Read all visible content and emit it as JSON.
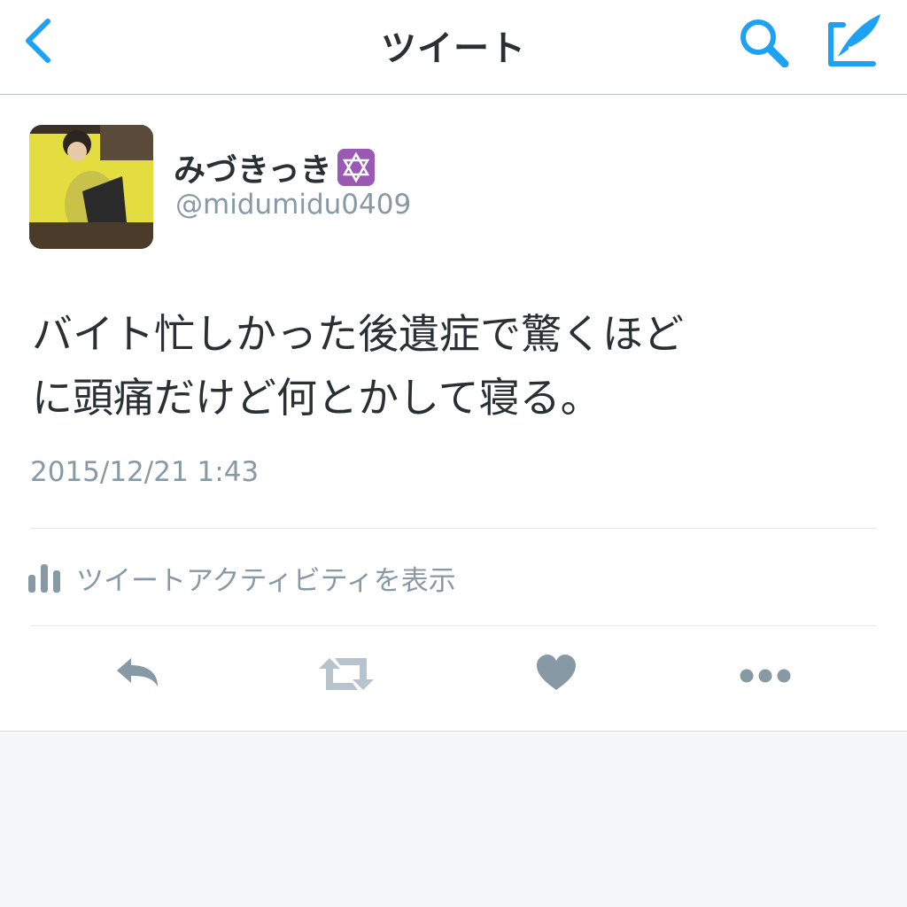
{
  "header": {
    "title": "ツイート",
    "back_icon": "chevron-left-icon",
    "search_icon": "search-icon",
    "compose_icon": "compose-icon",
    "accent_color": "#1da1f2"
  },
  "tweet": {
    "author": {
      "display_name": "みづきっき",
      "badge_icon": "star-of-david-icon",
      "handle": "@midumidu0409"
    },
    "text_line1": "バイト忙しかった後遺症で驚くほど",
    "text_line2": "に頭痛だけど何とかして寝る。",
    "timestamp": "2015/12/21 1:43",
    "activity_label": "ツイートアクティビティを表示"
  },
  "actions": {
    "reply_icon": "reply-icon",
    "retweet_icon": "retweet-icon",
    "like_icon": "heart-icon",
    "more_icon": "more-icon"
  }
}
